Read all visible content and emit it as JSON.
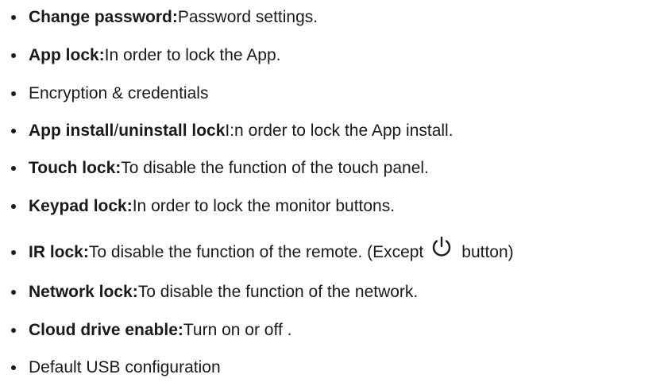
{
  "items": [
    {
      "term": "Change password:",
      "text": " Password settings."
    },
    {
      "term": "App lock:",
      "text": " In order to lock the App."
    },
    {
      "term": "",
      "text": "Encryption & credentials"
    },
    {
      "term": "App install",
      "sep": "/",
      "term2": "uninstall lock",
      "text": " I:n order to lock the App install."
    },
    {
      "term": "Touch lock:",
      "text": " To disable the function of the touch panel."
    },
    {
      "term": "Keypad lock:",
      "text": " In order to lock the monitor buttons."
    },
    {
      "term": "IR lock:",
      "text": " To disable the function of the remote. (Except",
      "icon": "power-icon",
      "after": "button)"
    },
    {
      "term": "Network lock:",
      "text": " To disable the function of the network."
    },
    {
      "term": "Cloud drive enable:",
      "text": " Turn on or off ."
    },
    {
      "term": "",
      "text": "Default USB configuration"
    }
  ]
}
